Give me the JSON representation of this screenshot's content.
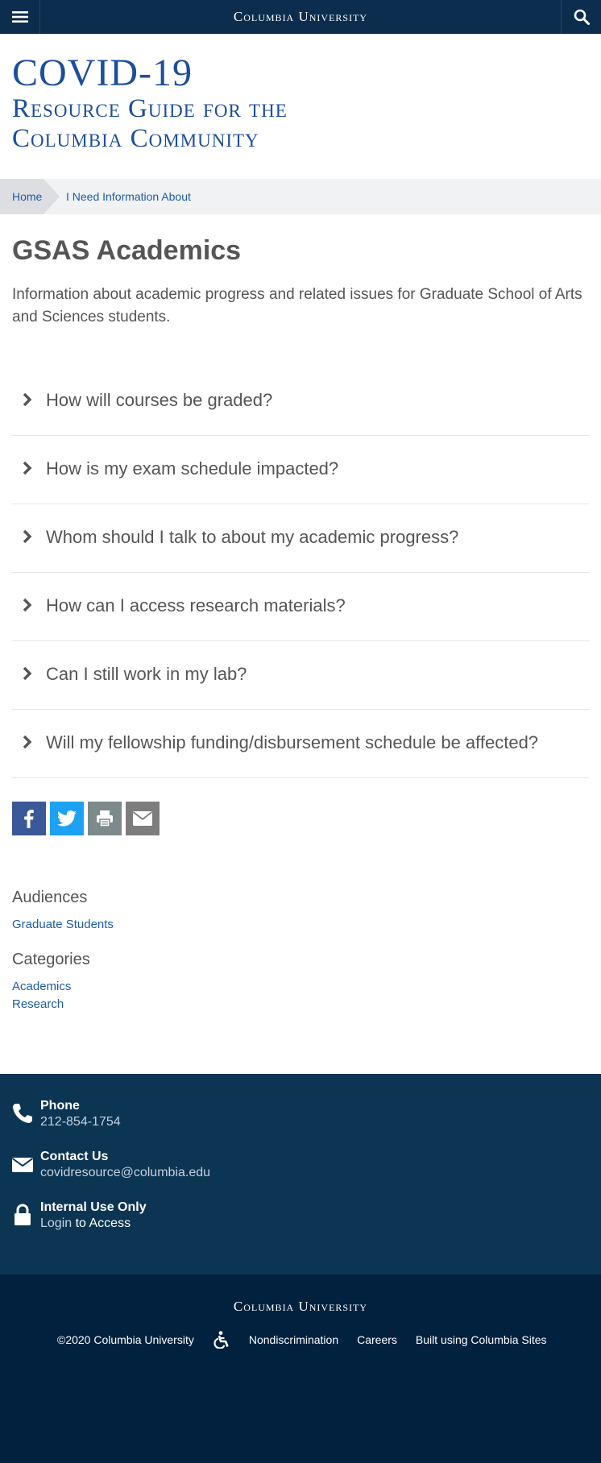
{
  "topbar": {
    "title": "Columbia University",
    "menu_icon": "hamburger-menu-icon",
    "search_icon": "search-icon"
  },
  "site_title": {
    "line1": "COVID-19",
    "line2": "Resource Guide for the",
    "line3": "Columbia Community"
  },
  "breadcrumb": {
    "home": "Home",
    "current": "I Need Information About"
  },
  "main": {
    "heading": "GSAS Academics",
    "intro": "Information about academic progress and related issues for Graduate School of Arts and Sciences students.",
    "faq": [
      "How will courses be graded?",
      "How is my exam schedule impacted?",
      "Whom should I talk to about my academic progress?",
      "How can I access research materials?",
      "Can I still work in my lab?",
      "Will my fellowship funding/disbursement schedule be affected?"
    ]
  },
  "share": {
    "facebook_color": "#3b5998",
    "twitter_color": "#1da1f2",
    "print_color": "#7d8a8c",
    "email_color": "#7d7d7d"
  },
  "taxonomy": {
    "audiences_heading": "Audiences",
    "audiences": [
      "Graduate Students"
    ],
    "categories_heading": "Categories",
    "categories": [
      "Academics",
      "Research"
    ]
  },
  "contact": {
    "phone_label": "Phone",
    "phone_value": "212-854-1754",
    "email_label": "Contact Us",
    "email_value": "covidresource@columbia.edu",
    "internal_label": "Internal Use Only",
    "login_link": "Login",
    "login_tail": " to Access"
  },
  "footer": {
    "title": "Columbia University",
    "copyright": "©2020 Columbia University",
    "nondiscrimination": "Nondiscrimination",
    "careers": "Careers",
    "built_with": "Built using Columbia Sites"
  },
  "colors": {
    "topbar": "#0c2d4d",
    "brand_blue": "#1b4e9b",
    "link_blue": "#1f5ba6",
    "contact_bg": "#0c3453",
    "footer_bg": "#01213f"
  }
}
